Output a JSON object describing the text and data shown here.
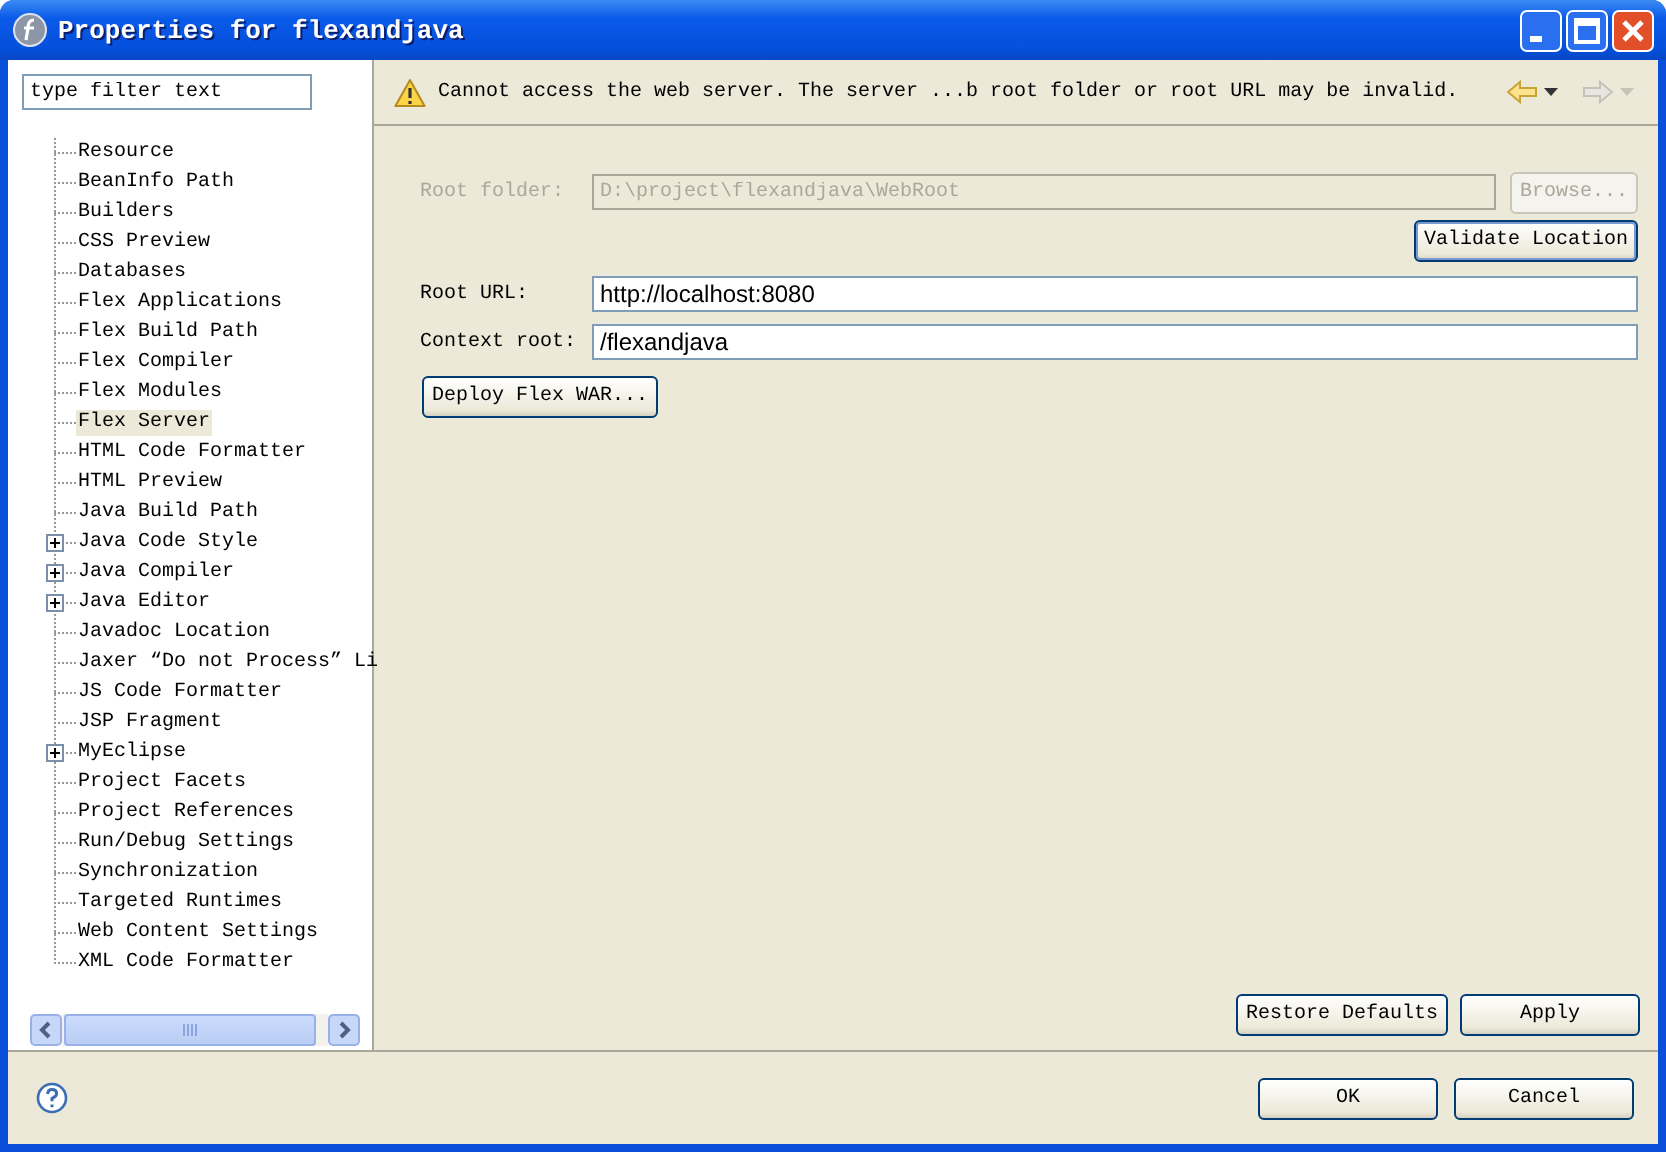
{
  "window": {
    "title": "Properties for flexandjava"
  },
  "filter": {
    "value": "type filter text"
  },
  "tree": {
    "items": [
      {
        "label": "Resource",
        "kind": "leaf",
        "selected": false
      },
      {
        "label": "BeanInfo Path",
        "kind": "leaf",
        "selected": false
      },
      {
        "label": "Builders",
        "kind": "leaf",
        "selected": false
      },
      {
        "label": "CSS Preview",
        "kind": "leaf",
        "selected": false
      },
      {
        "label": "Databases",
        "kind": "leaf",
        "selected": false
      },
      {
        "label": "Flex Applications",
        "kind": "leaf",
        "selected": false
      },
      {
        "label": "Flex Build Path",
        "kind": "leaf",
        "selected": false
      },
      {
        "label": "Flex Compiler",
        "kind": "leaf",
        "selected": false
      },
      {
        "label": "Flex Modules",
        "kind": "leaf",
        "selected": false
      },
      {
        "label": "Flex Server",
        "kind": "leaf",
        "selected": true
      },
      {
        "label": "HTML Code Formatter",
        "kind": "leaf",
        "selected": false
      },
      {
        "label": "HTML Preview",
        "kind": "leaf",
        "selected": false
      },
      {
        "label": "Java Build Path",
        "kind": "leaf",
        "selected": false
      },
      {
        "label": "Java Code Style",
        "kind": "group",
        "selected": false
      },
      {
        "label": "Java Compiler",
        "kind": "group",
        "selected": false
      },
      {
        "label": "Java Editor",
        "kind": "group",
        "selected": false
      },
      {
        "label": "Javadoc Location",
        "kind": "leaf",
        "selected": false
      },
      {
        "label": "Jaxer “Do not Process” Li",
        "kind": "leaf",
        "selected": false
      },
      {
        "label": "JS Code Formatter",
        "kind": "leaf",
        "selected": false
      },
      {
        "label": "JSP Fragment",
        "kind": "leaf",
        "selected": false
      },
      {
        "label": "MyEclipse",
        "kind": "group",
        "selected": false
      },
      {
        "label": "Project Facets",
        "kind": "leaf",
        "selected": false
      },
      {
        "label": "Project References",
        "kind": "leaf",
        "selected": false
      },
      {
        "label": "Run/Debug Settings",
        "kind": "leaf",
        "selected": false
      },
      {
        "label": "Synchronization",
        "kind": "leaf",
        "selected": false
      },
      {
        "label": "Targeted Runtimes",
        "kind": "leaf",
        "selected": false
      },
      {
        "label": "Web Content Settings",
        "kind": "leaf",
        "selected": false
      },
      {
        "label": "XML Code Formatter",
        "kind": "leaf",
        "selected": false
      }
    ]
  },
  "message": {
    "kind": "warning",
    "text": "Cannot access the web server. The server ...b root folder or root URL may be invalid."
  },
  "nav": {
    "back": {
      "disabled": false
    },
    "forward": {
      "disabled": true
    }
  },
  "form": {
    "root_folder": {
      "label": "Root folder:",
      "value": "D:\\project\\flexandjava\\WebRoot",
      "disabled": true
    },
    "browse_button": {
      "label": "Browse...",
      "disabled": true
    },
    "validate_button": {
      "label": "Validate Location"
    },
    "root_url": {
      "label": "Root URL:",
      "value": "http://localhost:8080"
    },
    "context_root": {
      "label": "Context root:",
      "value": "/flexandjava"
    },
    "deploy_button": {
      "label": "Deploy Flex WAR..."
    }
  },
  "page_buttons": [
    "Restore Defaults",
    "Apply"
  ],
  "dialog_buttons": [
    "OK",
    "Cancel"
  ]
}
